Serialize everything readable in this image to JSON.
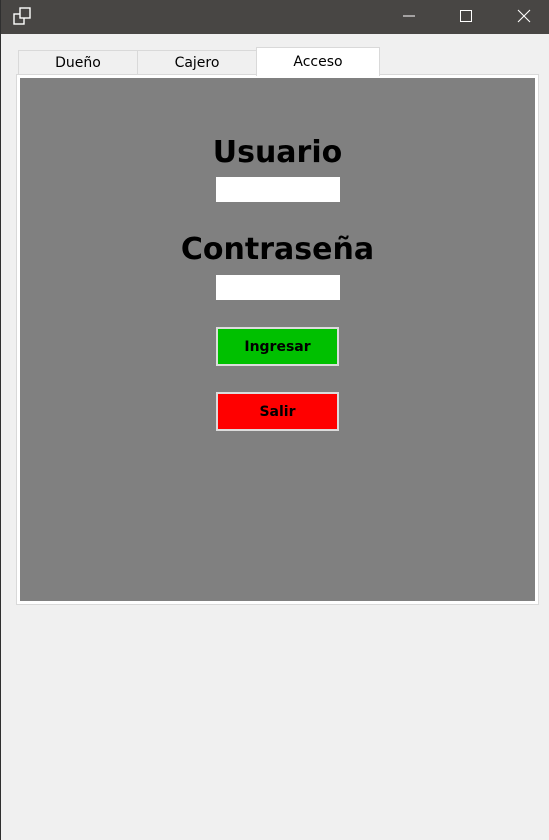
{
  "titlebar": {
    "icons": [
      "restore-windows-icon",
      "minimize-icon",
      "maximize-icon",
      "close-icon"
    ]
  },
  "tabs": [
    {
      "label": "Dueño",
      "selected": false
    },
    {
      "label": "Cajero",
      "selected": false
    },
    {
      "label": "Acceso",
      "selected": true
    }
  ],
  "login": {
    "user_label": "Usuario",
    "user_value": "",
    "password_label": "Contraseña",
    "password_value": "",
    "ingresar_label": "Ingresar",
    "salir_label": "Salir"
  },
  "colors": {
    "titlebar": "#484644",
    "panel_background": "#808080",
    "ingresar_button": "#00c000",
    "salir_button": "#ff0000",
    "window_background": "#f0f0f0"
  }
}
